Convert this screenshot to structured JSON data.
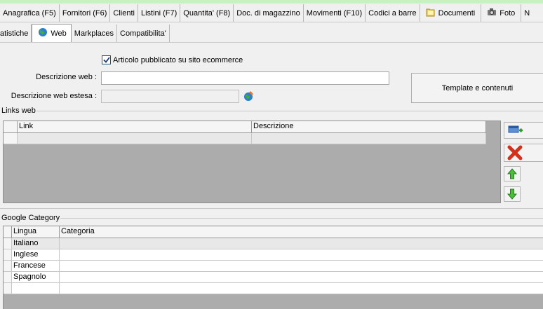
{
  "tabs_row1": [
    {
      "label": "Anagrafica (F5)"
    },
    {
      "label": "Fornitori (F6)"
    },
    {
      "label": "Clienti"
    },
    {
      "label": "Listini (F7)"
    },
    {
      "label": "Quantita' (F8)"
    },
    {
      "label": "Doc. di magazzino"
    },
    {
      "label": "Movimenti (F10)"
    },
    {
      "label": "Codici a barre"
    },
    {
      "label": "Documenti",
      "icon": "folder-icon"
    },
    {
      "label": "Foto",
      "icon": "camera-icon"
    },
    {
      "label": "N"
    }
  ],
  "tabs_row2": [
    {
      "label": "atistiche"
    },
    {
      "label": "Web",
      "icon": "globe-icon",
      "active": true
    },
    {
      "label": "Markplaces"
    },
    {
      "label": "Compatibilita'"
    }
  ],
  "web": {
    "published_label": "Articolo pubblicato su sito ecommerce",
    "published_checked": true,
    "descr_label": "Descrizione web :",
    "descr_value": "",
    "descr_ext_label": "Descrizione web estesa :",
    "descr_ext_value": "",
    "template_button": "Template e contenuti"
  },
  "links": {
    "title": "Links web",
    "columns": [
      "Link",
      "Descrizione"
    ],
    "rows": [
      [
        "",
        ""
      ]
    ]
  },
  "google": {
    "title": "Google Category",
    "columns": [
      "Lingua",
      "Categoria"
    ],
    "rows": [
      {
        "lingua": "Italiano",
        "categoria": ""
      },
      {
        "lingua": "Inglese",
        "categoria": ""
      },
      {
        "lingua": "Francese",
        "categoria": ""
      },
      {
        "lingua": "Spagnolo",
        "categoria": ""
      },
      {
        "lingua": "",
        "categoria": ""
      }
    ]
  },
  "colors": {
    "accent_green": "#c8f0c0",
    "grid_bg": "#acacac",
    "selected_row": "#e8e8e8"
  }
}
